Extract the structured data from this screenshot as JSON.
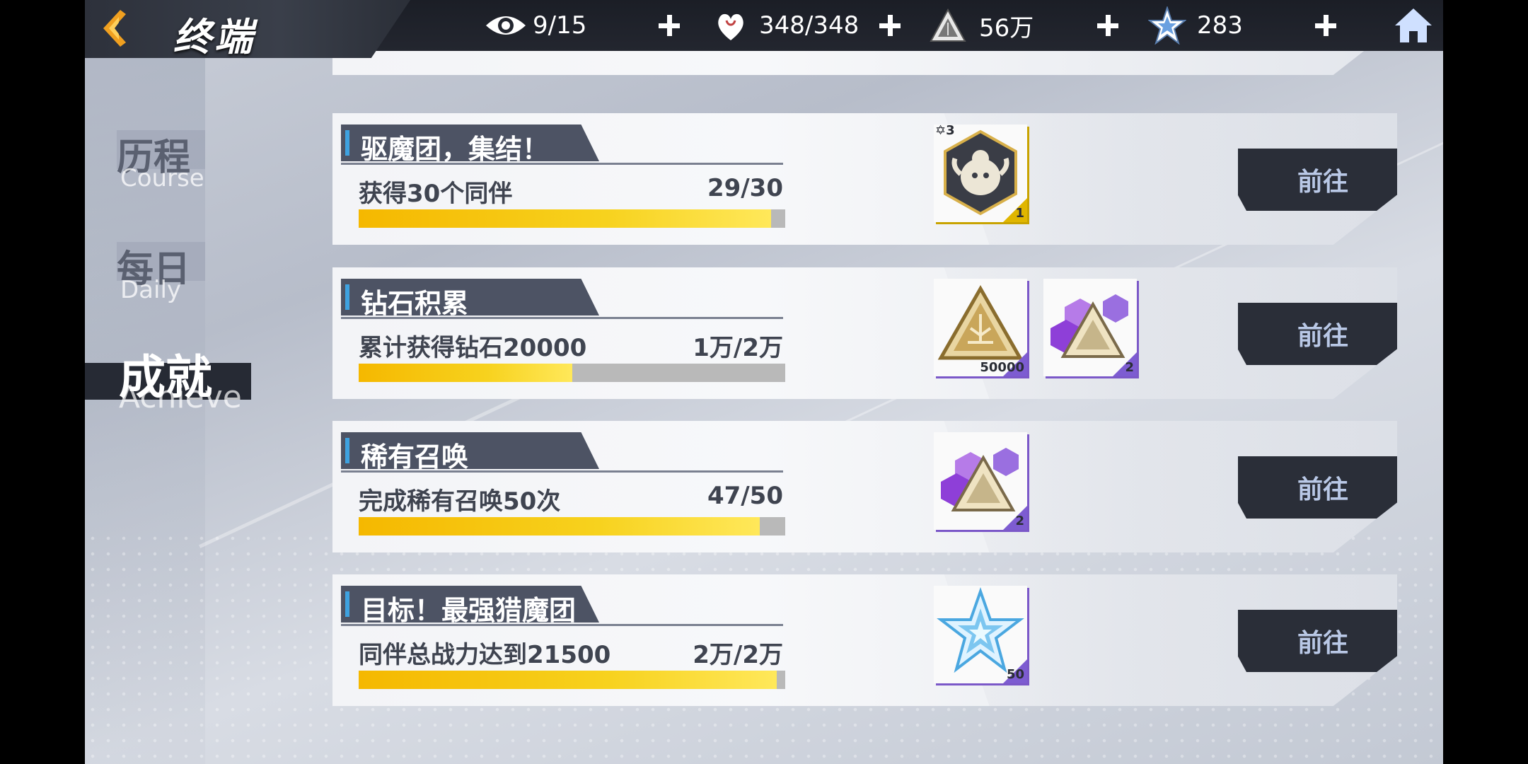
{
  "header": {
    "title": "终端",
    "resources": [
      {
        "icon": "eye-icon",
        "value": "9/15"
      },
      {
        "icon": "heart-icon",
        "value": "348/348"
      },
      {
        "icon": "diamond-triangle-icon",
        "value": "56万"
      },
      {
        "icon": "blue-star-icon",
        "value": "283"
      }
    ]
  },
  "sidebar": {
    "items": [
      {
        "cn": "历程",
        "en": "Course"
      },
      {
        "cn": "每日",
        "en": "Daily"
      },
      {
        "cn": "成就",
        "en": "Achieve"
      }
    ],
    "active": 2
  },
  "tasks": [
    {
      "title": "驱魔团，集结！",
      "desc": "获得30个同伴",
      "progress": "29/30",
      "fill": 0.967,
      "rewards": [
        {
          "icon": "demon-token-icon",
          "qty": "1",
          "stars": "3"
        }
      ],
      "button": "前往"
    },
    {
      "title": "钻石积累",
      "desc": "累计获得钻石20000",
      "progress": "1万/2万",
      "fill": 0.5,
      "rewards": [
        {
          "icon": "gold-triangle-icon",
          "qty": "50000"
        },
        {
          "icon": "purple-crystal-icon",
          "qty": "2"
        }
      ],
      "button": "前往"
    },
    {
      "title": "稀有召唤",
      "desc": "完成稀有召唤50次",
      "progress": "47/50",
      "fill": 0.94,
      "rewards": [
        {
          "icon": "purple-crystal-icon",
          "qty": "2"
        }
      ],
      "button": "前往"
    },
    {
      "title": "目标！最强猎魔团",
      "desc": "同伴总战力达到21500",
      "progress": "2万/2万",
      "fill": 0.98,
      "rewards": [
        {
          "icon": "blue-star-icon",
          "qty": "50"
        }
      ],
      "button": "前往"
    }
  ]
}
